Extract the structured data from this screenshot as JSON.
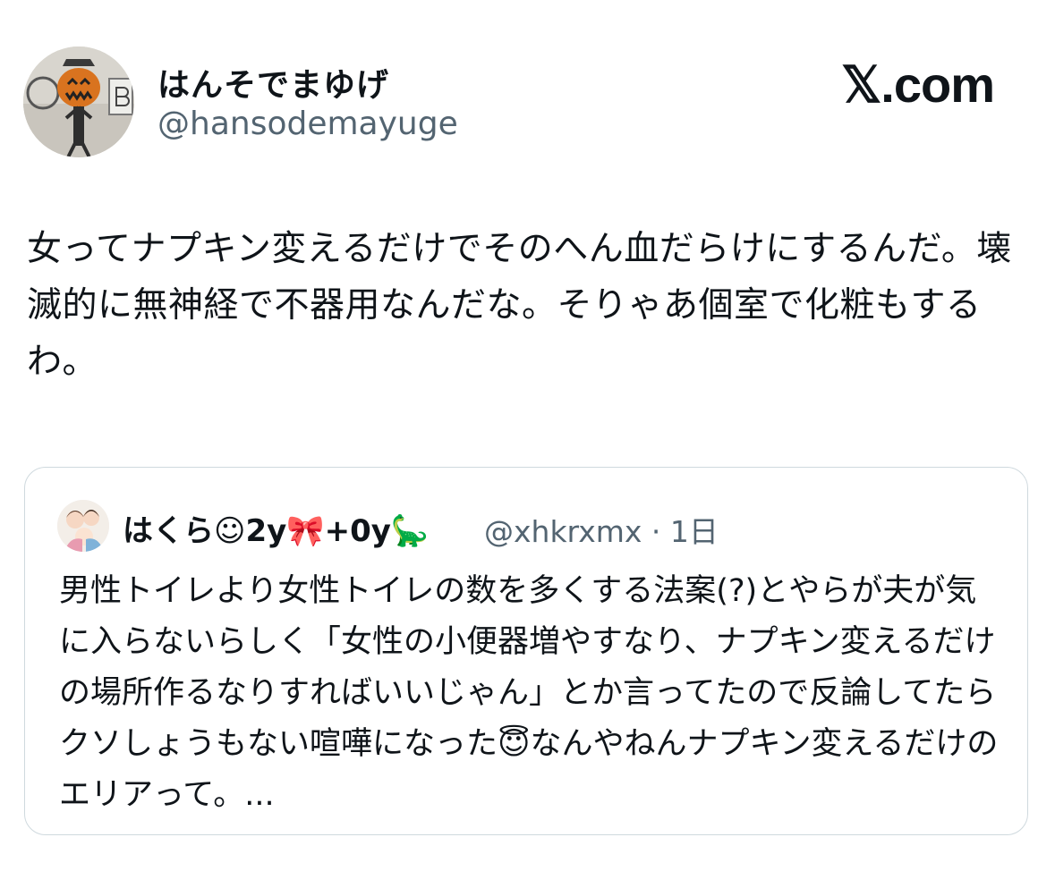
{
  "tweet": {
    "author": {
      "display_name": "はんそでまゆげ",
      "handle": "@hansodemayuge",
      "avatar": "pumpkin-head-avatar"
    },
    "brand": "𝕏.com",
    "text": "女ってナプキン変えるだけでそのへん血だらけにするんだ。壊滅的に無神経で不器用なんだな。そりゃあ個室で化粧もするわ。"
  },
  "quote": {
    "author": {
      "display_name": "はくら☺2y🎀+0y🦕",
      "handle_time": "@xhkrxmx · 1日",
      "avatar": "illustrated-family-avatar"
    },
    "text": "男性トイレより女性トイレの数を多くする法案(?)とやらが夫が気に入らないらしく「女性の小便器増やすなり、ナプキン変えるだけの場所作るなりすればいいじゃん」とか言ってたので反論してたらクソしょうもない喧嘩になった😇なんやねんナプキン変えるだけのエリアって。..."
  }
}
